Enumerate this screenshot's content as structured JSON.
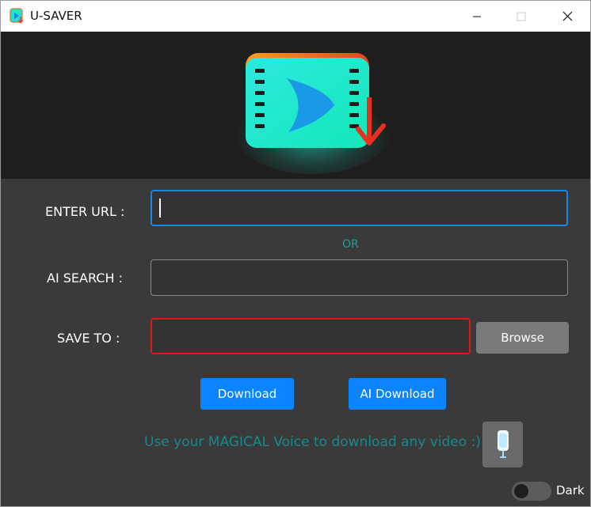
{
  "window": {
    "title": "U-SAVER",
    "controls": {
      "minimize": "minimize",
      "maximize": "maximize",
      "close": "close"
    }
  },
  "form": {
    "url_label": "ENTER URL :",
    "url_value": "",
    "or_text": "OR",
    "ai_search_label": "AI SEARCH :",
    "ai_search_value": "",
    "save_to_label": "SAVE TO :",
    "save_to_value": "",
    "browse_label": "Browse"
  },
  "actions": {
    "download_label": "Download",
    "ai_download_label": "AI Download"
  },
  "voice": {
    "text": "Use your MAGICAL Voice to download any video :)"
  },
  "theme": {
    "dark_label": "Dark",
    "dark_enabled": false
  },
  "colors": {
    "accent_blue": "#0a84ff",
    "teal_text": "#178a8a",
    "error_red": "#e01818",
    "banner_bg": "#1e1e1e",
    "panel_bg": "#3a3a3a"
  },
  "icons": {
    "app": "video-download-icon",
    "logo": "video-download-logo",
    "mic": "microphone-icon"
  }
}
